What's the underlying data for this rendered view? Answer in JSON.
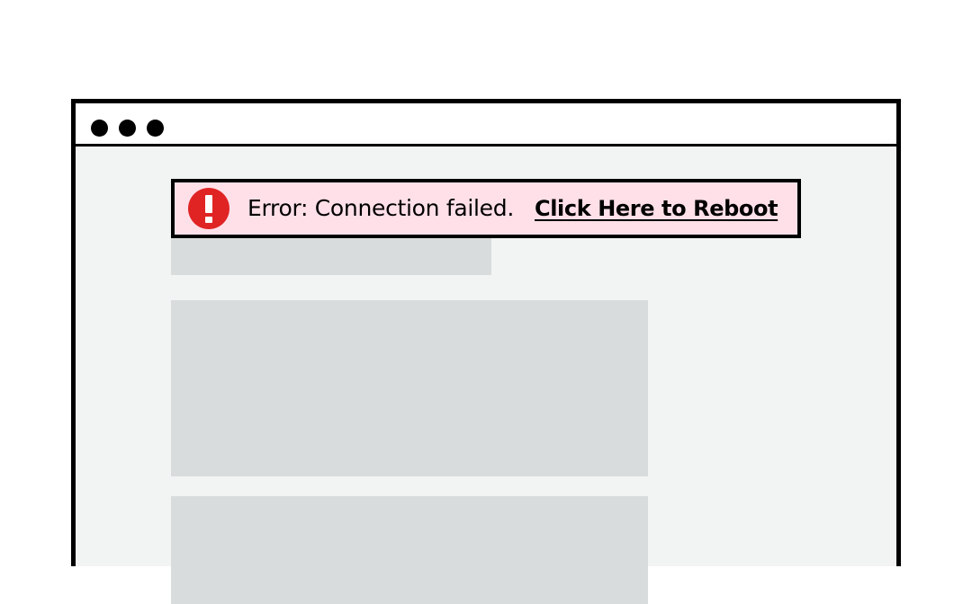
{
  "window": {
    "controls": [
      "dot",
      "dot",
      "dot"
    ]
  },
  "error_banner": {
    "icon": "error-exclamation-icon",
    "message": "Error: Connection failed.",
    "link_label": "Click Here to Reboot",
    "icon_color": "#e02424",
    "background_color": "#ffe0e8"
  },
  "colors": {
    "page_background": "#f2f4f3",
    "placeholder": "#d9dcdc",
    "frame": "#000000"
  }
}
